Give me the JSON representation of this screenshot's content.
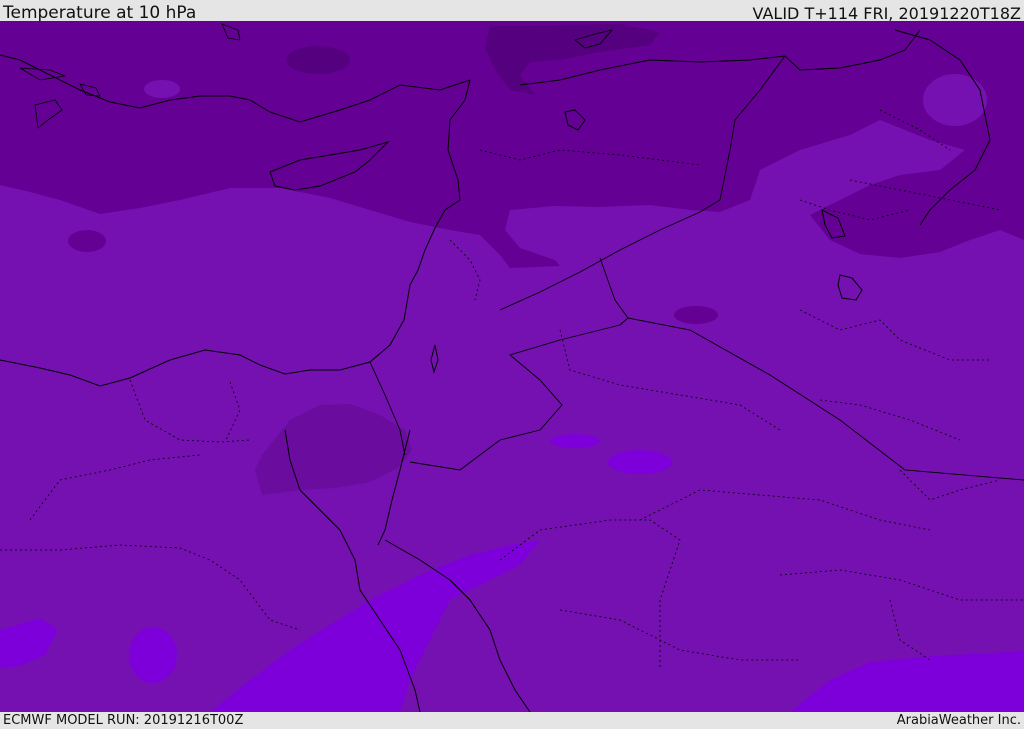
{
  "header": {
    "title": "Temperature at 10 hPa",
    "valid_time": "VALID T+114 FRI, 20191220T18Z"
  },
  "footer": {
    "model_run": "ECMWF MODEL RUN: 20191216T00Z",
    "credit": "ArabiaWeather Inc."
  },
  "colors": {
    "band_coldest": "#55007f",
    "band_cold": "#650094",
    "band_mid": "#7511b0",
    "band_warm": "#7d00db",
    "coastline": "#000000",
    "border": "#000000"
  }
}
